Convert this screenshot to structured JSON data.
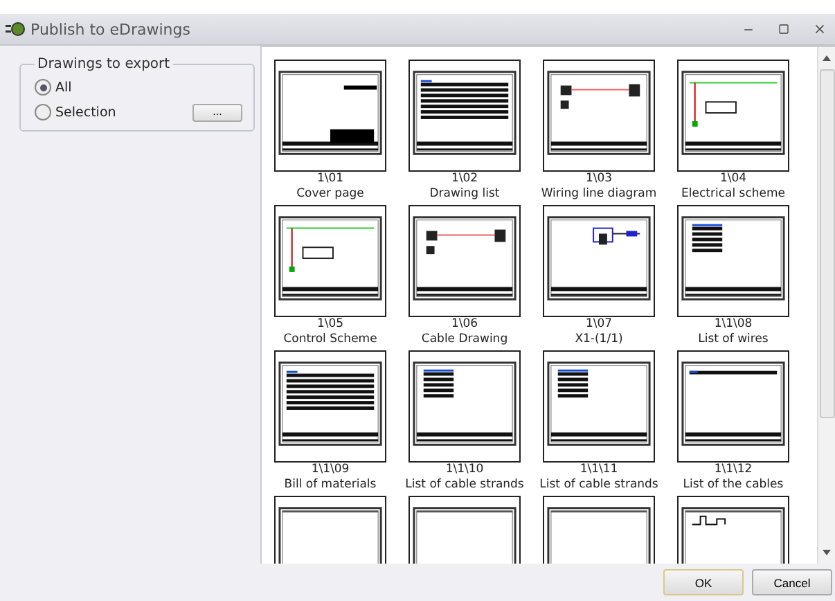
{
  "window": {
    "title": "Publish to eDrawings"
  },
  "export_group": {
    "title": "Drawings to export",
    "options": [
      {
        "label": "All",
        "selected": true
      },
      {
        "label": "Selection",
        "selected": false
      }
    ],
    "browse_button": "..."
  },
  "thumbnails": [
    {
      "number": "1\\01",
      "title": "Cover page",
      "kind": "cover"
    },
    {
      "number": "1\\02",
      "title": "Drawing list",
      "kind": "table"
    },
    {
      "number": "1\\03",
      "title": "Wiring line diagram",
      "kind": "wiring"
    },
    {
      "number": "1\\04",
      "title": "Electrical scheme",
      "kind": "scheme"
    },
    {
      "number": "1\\05",
      "title": "Control Scheme",
      "kind": "scheme"
    },
    {
      "number": "1\\06",
      "title": "Cable Drawing",
      "kind": "wiring"
    },
    {
      "number": "1\\07",
      "title": "X1-(1/1)",
      "kind": "terminal"
    },
    {
      "number": "1\\1\\08",
      "title": "List of wires",
      "kind": "smalltable"
    },
    {
      "number": "1\\1\\09",
      "title": "Bill of materials",
      "kind": "table"
    },
    {
      "number": "1\\1\\10",
      "title": "List of cable strands",
      "kind": "smalltable"
    },
    {
      "number": "1\\1\\11",
      "title": "List of cable strands",
      "kind": "smalltable"
    },
    {
      "number": "1\\1\\12",
      "title": "List of the cables",
      "kind": "header"
    },
    {
      "kind": "blank"
    },
    {
      "kind": "blank"
    },
    {
      "kind": "blank"
    },
    {
      "kind": "chart"
    }
  ],
  "buttons": [
    {
      "label": "OK",
      "kind": "default"
    },
    {
      "label": "Cancel",
      "kind": "normal"
    }
  ]
}
